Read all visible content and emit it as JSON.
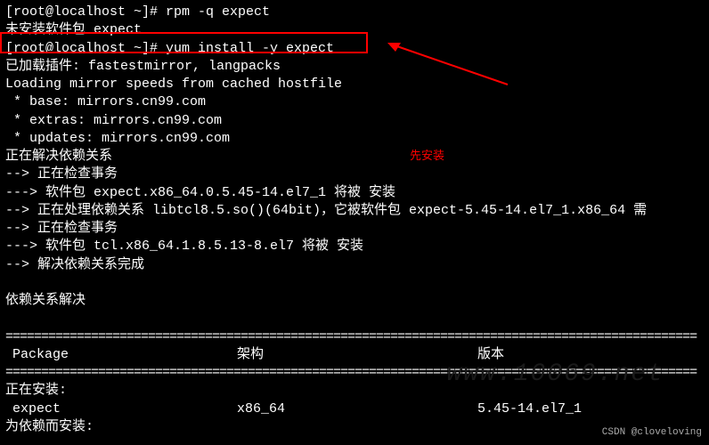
{
  "lines": {
    "l1_prompt": "[root@localhost ~]# ",
    "l1_cmd": "rpm -q expect",
    "l2": "未安装软件包 expect",
    "l3_prompt": "[root@localhost ~]# ",
    "l3_cmd": "yum install -y expect",
    "l4": "已加载插件: fastestmirror, langpacks",
    "l5": "Loading mirror speeds from cached hostfile",
    "l6": " * base: mirrors.cn99.com",
    "l7": " * extras: mirrors.cn99.com",
    "l8": " * updates: mirrors.cn99.com",
    "l9": "正在解决依赖关系",
    "l10": "--> 正在检查事务",
    "l11": "---> 软件包 expect.x86_64.0.5.45-14.el7_1 将被 安装",
    "l12": "--> 正在处理依赖关系 libtcl8.5.so()(64bit)，它被软件包 expect-5.45-14.el7_1.x86_64 需",
    "l13": "--> 正在检查事务",
    "l14": "---> 软件包 tcl.x86_64.1.8.5.13-8.el7 将被 安装",
    "l15": "--> 解决依赖关系完成",
    "l17": "依赖关系解决"
  },
  "annotation": {
    "red_text": "先安装"
  },
  "table": {
    "header": {
      "package": "Package",
      "arch": "架构",
      "version": "版本"
    },
    "section_install": "正在安装:",
    "row1": {
      "package": " expect",
      "arch": "x86_64",
      "version": "5.45-14.el7_1"
    },
    "section_dep": "为依赖而安装:"
  },
  "separator": "=================================================================================================",
  "watermark": "www.10069.net",
  "attribution": "CSDN @cloveloving"
}
